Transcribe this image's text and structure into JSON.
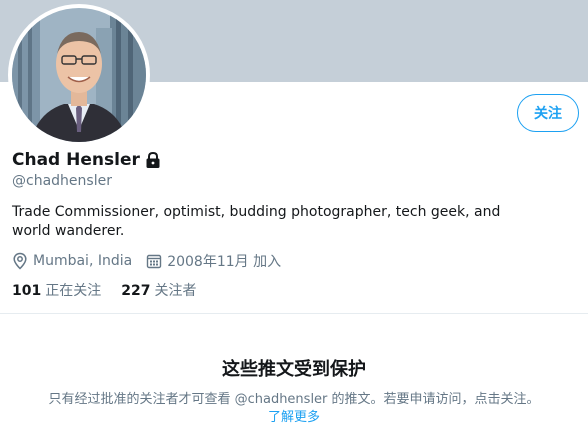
{
  "profile": {
    "display_name": "Chad Hensler",
    "handle": "@chadhensler",
    "bio": "Trade Commissioner, optimist, budding photographer, tech geek, and world wanderer.",
    "location": "Mumbai, India",
    "joined": "2008年11月 加入",
    "following_count": "101",
    "following_label": "正在关注",
    "followers_count": "227",
    "followers_label": "关注者"
  },
  "actions": {
    "follow_label": "关注"
  },
  "protected": {
    "title": "这些推文受到保护",
    "description": "只有经过批准的关注者才可查看 @chadhensler 的推文。若要申请访问，点击关注。",
    "learn_more": "了解更多"
  },
  "colors": {
    "accent": "#1da1f2",
    "banner": "#c5cfd8",
    "secondary_text": "#657786"
  }
}
